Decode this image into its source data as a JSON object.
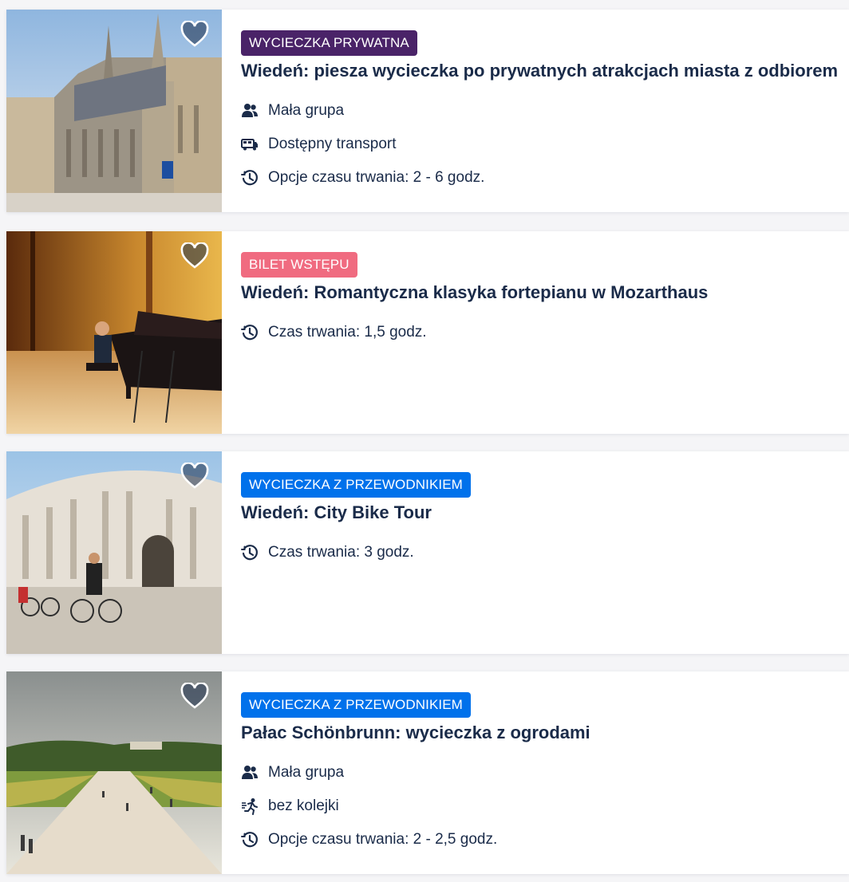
{
  "cards": [
    {
      "badge": "WYCIECZKA PRYWATNA",
      "badge_color": "#4a2368",
      "title": "Wiedeń: piesza wycieczka po prywatnych atrakcjach miasta z odbiorem",
      "features": [
        {
          "icon": "group-icon",
          "text": "Mała grupa"
        },
        {
          "icon": "bus-icon",
          "text": "Dostępny transport"
        },
        {
          "icon": "clock-icon",
          "text": "Opcje czasu trwania: 2 - 6 godz."
        }
      ]
    },
    {
      "badge": "BILET WSTĘPU",
      "badge_color": "#f06b80",
      "title": "Wiedeń: Romantyczna klasyka fortepianu w Mozarthaus",
      "features": [
        {
          "icon": "clock-icon",
          "text": "Czas trwania: 1,5 godz."
        }
      ]
    },
    {
      "badge": "WYCIECZKA Z PRZEWODNIKIEM",
      "badge_color": "#0071eb",
      "title": "Wiedeń: City Bike Tour",
      "features": [
        {
          "icon": "clock-icon",
          "text": "Czas trwania: 3 godz."
        }
      ]
    },
    {
      "badge": "WYCIECZKA Z PRZEWODNIKIEM",
      "badge_color": "#0071eb",
      "title": "Pałac Schönbrunn: wycieczka z ogrodami",
      "features": [
        {
          "icon": "group-icon",
          "text": "Mała grupa"
        },
        {
          "icon": "skip-line-icon",
          "text": "bez kolejki"
        },
        {
          "icon": "clock-icon",
          "text": "Opcje czasu trwania: 2 - 2,5 godz."
        }
      ]
    }
  ]
}
